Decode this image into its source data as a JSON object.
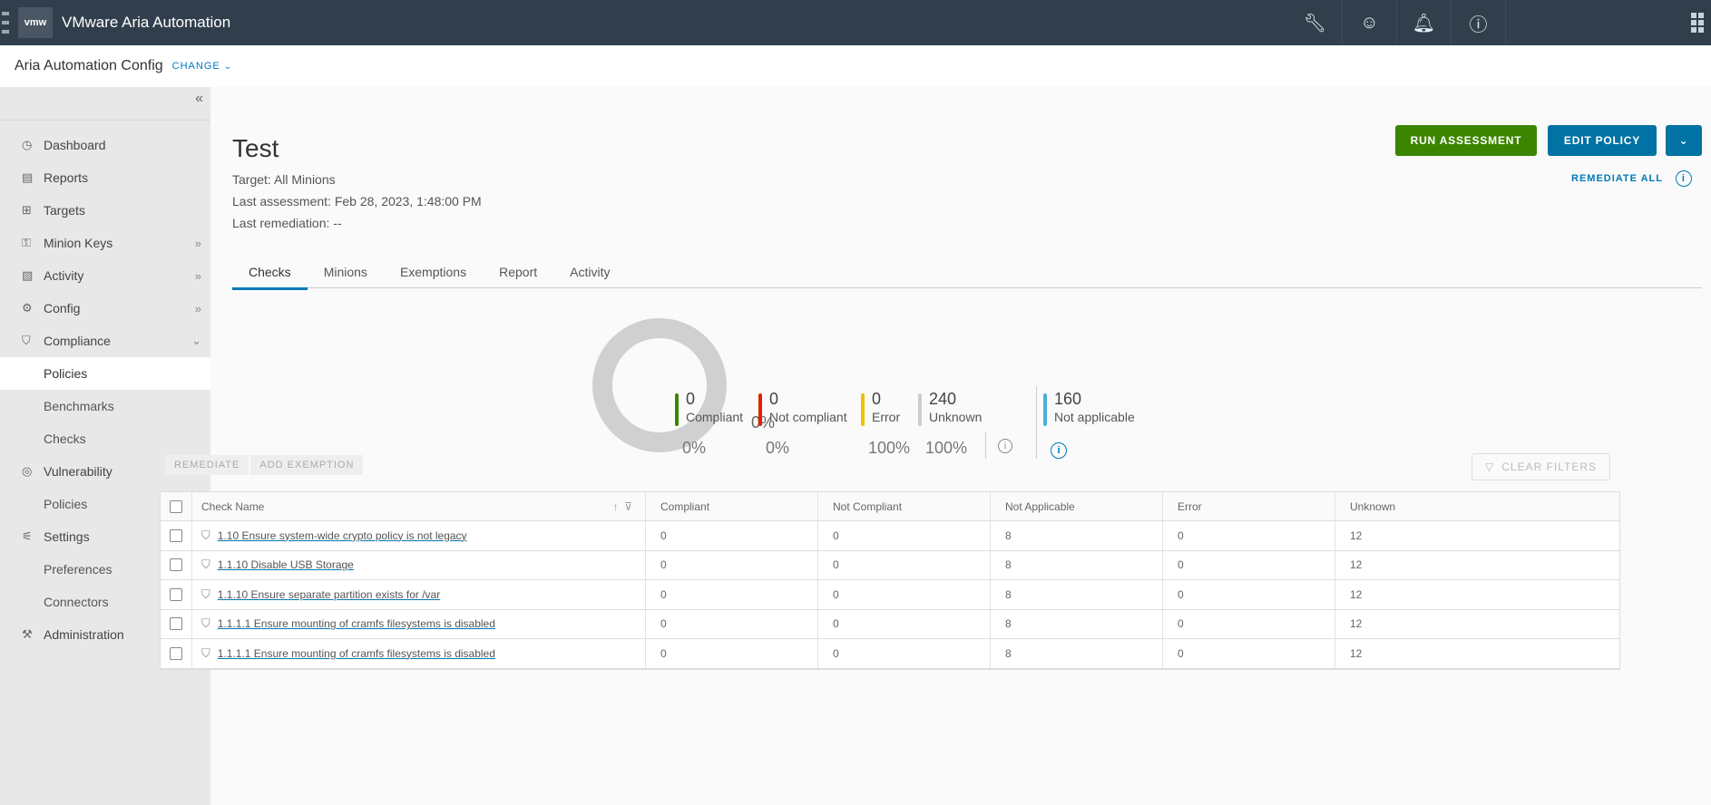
{
  "topbar": {
    "logo": "vmw",
    "brand": "VMware Aria Automation",
    "icons": [
      "wrench-icon",
      "smiley-icon",
      "bell-icon",
      "help-icon"
    ]
  },
  "subbar": {
    "title": "Aria Automation Config",
    "change": "CHANGE"
  },
  "sidebar": {
    "collapse": "«",
    "items": [
      {
        "label": "Dashboard",
        "icon": "◷"
      },
      {
        "label": "Reports",
        "icon": "▤"
      },
      {
        "label": "Targets",
        "icon": "⊞"
      },
      {
        "label": "Minion Keys",
        "icon": "⚿",
        "arrow": "»"
      },
      {
        "label": "Activity",
        "icon": "▧",
        "arrow": "»"
      },
      {
        "label": "Config",
        "icon": "⚙",
        "arrow": "»"
      },
      {
        "label": "Compliance",
        "icon": "⛉",
        "arrow": "⌄"
      },
      {
        "label": "Policies",
        "sub": true,
        "active": true
      },
      {
        "label": "Benchmarks",
        "sub": true
      },
      {
        "label": "Checks",
        "sub": true
      },
      {
        "label": "Vulnerability",
        "icon": "◎",
        "arrow": "⌄"
      },
      {
        "label": "Policies",
        "sub": true
      },
      {
        "label": "Settings",
        "icon": "⚟",
        "arrow": "⌄"
      },
      {
        "label": "Preferences",
        "sub": true
      },
      {
        "label": "Connectors",
        "sub": true
      },
      {
        "label": "Administration",
        "icon": "⚒",
        "arrow": "›"
      }
    ]
  },
  "page": {
    "title": "Test",
    "target_label": "Target:",
    "target_value": "All Minions",
    "last_assessment_label": "Last assessment:",
    "last_assessment_value": "Feb 28, 2023, 1:48:00 PM",
    "last_remediation_label": "Last remediation:",
    "last_remediation_value": "--",
    "run_assessment": "RUN ASSESSMENT",
    "edit_policy": "EDIT POLICY",
    "more": "⌄",
    "remediate_all": "REMEDIATE ALL",
    "tabs": [
      "Checks",
      "Minions",
      "Exemptions",
      "Report",
      "Activity"
    ],
    "active_tab": "Checks"
  },
  "summary": {
    "donut_center_pct": "0%",
    "stats": [
      {
        "count": "0",
        "label": "Compliant",
        "pct": "0%",
        "color": "#3c8500"
      },
      {
        "count": "0",
        "label": "Not compliant",
        "pct": "0%",
        "color": "#e12200"
      },
      {
        "count": "0",
        "label": "Error",
        "pct": "100%",
        "color": "#efc006"
      },
      {
        "count": "240",
        "label": "Unknown",
        "pct": "100%",
        "color": "#cccccc"
      },
      {
        "count": "160",
        "label": "Not applicable",
        "pct": "",
        "color": "#49afd9"
      }
    ]
  },
  "actions": {
    "remediate": "REMEDIATE",
    "add_exemption": "ADD EXEMPTION",
    "clear_filters": "CLEAR FILTERS"
  },
  "grid": {
    "columns": [
      "Check Name",
      "Compliant",
      "Not Compliant",
      "Not Applicable",
      "Error",
      "Unknown"
    ],
    "rows": [
      {
        "name": "1.10 Ensure system-wide crypto policy is not legacy",
        "compliant": "0",
        "not_compliant": "0",
        "not_applicable": "8",
        "error": "0",
        "unknown": "12"
      },
      {
        "name": "1.1.10 Disable USB Storage",
        "compliant": "0",
        "not_compliant": "0",
        "not_applicable": "8",
        "error": "0",
        "unknown": "12"
      },
      {
        "name": "1.1.10 Ensure separate partition exists for /var",
        "compliant": "0",
        "not_compliant": "0",
        "not_applicable": "8",
        "error": "0",
        "unknown": "12"
      },
      {
        "name": "1.1.1.1 Ensure mounting of cramfs filesystems is disabled",
        "compliant": "0",
        "not_compliant": "0",
        "not_applicable": "8",
        "error": "0",
        "unknown": "12"
      },
      {
        "name": "1.1.1.1 Ensure mounting of cramfs filesystems is disabled",
        "compliant": "0",
        "not_compliant": "0",
        "not_applicable": "8",
        "error": "0",
        "unknown": "12"
      }
    ]
  }
}
